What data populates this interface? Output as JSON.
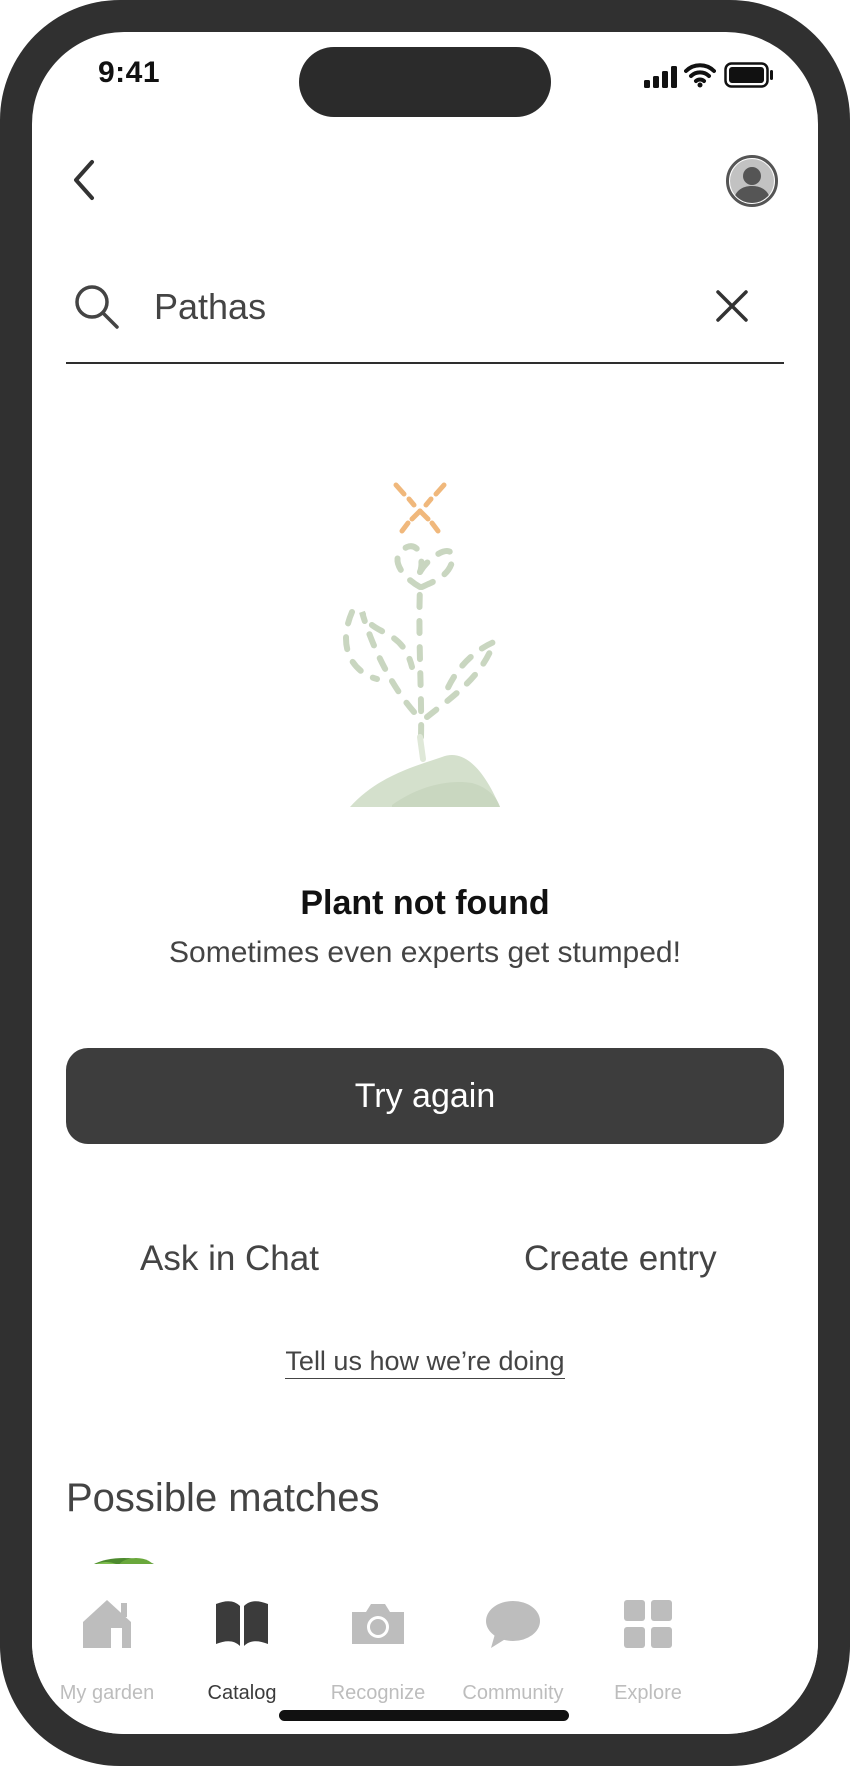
{
  "status_bar": {
    "time": "9:41"
  },
  "search": {
    "value": "Pathas"
  },
  "empty_state": {
    "title": "Plant not found",
    "subtitle": "Sometimes even experts get stumped!"
  },
  "actions": {
    "try_again": "Try again",
    "ask_in_chat": "Ask in Chat",
    "create_entry": "Create entry",
    "feedback": "Tell us how we’re doing"
  },
  "matches": {
    "title": "Possible matches"
  },
  "tab_bar": {
    "active": "Catalog",
    "items": [
      {
        "label": "My garden",
        "icon": "house-icon"
      },
      {
        "label": "Catalog",
        "icon": "book-icon"
      },
      {
        "label": "Recognize",
        "icon": "camera-icon"
      },
      {
        "label": "Community",
        "icon": "chat-bubble-icon"
      },
      {
        "label": "Explore",
        "icon": "grid-icon"
      }
    ]
  },
  "colors": {
    "frame": "#303030",
    "primary_button": "#3d3d3d",
    "text": "#444444",
    "tab_inactive": "#bdbdbd",
    "illustration_leaf": "#c9d6c0",
    "illustration_x": "#f0b87c"
  }
}
